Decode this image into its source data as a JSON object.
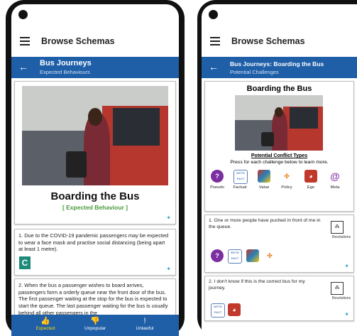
{
  "left_screen": {
    "appbar_title": "Browse Schemas",
    "subbar_title": "Bus Journeys",
    "subbar_subtitle": "Expected Behaviours",
    "card_title": "Boarding the Bus",
    "card_tag": "[ Expected Behaviour ]",
    "item1_text": "1. Due to the COVID-19 pandemic passengers may be expected to wear a face mask and practise social distancing (being apart at least 1 metre).",
    "item1_badge": "C",
    "item2_text": "2. When the bus a passenger wishes to board arrives, passengers form a orderly queue near the front door of the bus. The first passenger waiting at the stop for the bus is expected to start the queue. The last passenger waiting for the bus is usually behind all other passengers in the",
    "nav": [
      {
        "label": "Expected",
        "icon": "👍"
      },
      {
        "label": "Unpopular",
        "icon": "👎"
      },
      {
        "label": "Unlawful",
        "icon": "!"
      }
    ],
    "colors": {
      "primary": "#1f5fa8",
      "tag_green": "#4a9a3c"
    }
  },
  "right_screen": {
    "appbar_title": "Browse Schemas",
    "subbar_title": "Bus Journeys: Boarding the Bus",
    "subbar_subtitle": "Potential Challenges",
    "card_title": "Boarding the Bus",
    "conflict_heading": "Potential Conflict Types",
    "conflict_hint": "Press for each challenge below to learn more.",
    "conflict_types": [
      {
        "label": "Pseudo",
        "icon": "?",
        "color": "#7b2fa0"
      },
      {
        "label": "Factual",
        "icon": "MYTH FACT",
        "color": "#5a7fb8"
      },
      {
        "label": "Value",
        "icon": "value-icon",
        "color": "#c0392b"
      },
      {
        "label": "Policy",
        "icon": "policy-icon",
        "color": "#e67e22"
      },
      {
        "label": "Ego",
        "icon": "ego-icon",
        "color": "#c0392b"
      },
      {
        "label": "Meta",
        "icon": "@",
        "color": "#8e44ad"
      }
    ],
    "challenge1_text": "1. One or more people have pushed in front of me in the queue.",
    "challenge2_text": "2. I don't know if this is the correct bus for my journey.",
    "resolutions_label": "Resolutions"
  }
}
